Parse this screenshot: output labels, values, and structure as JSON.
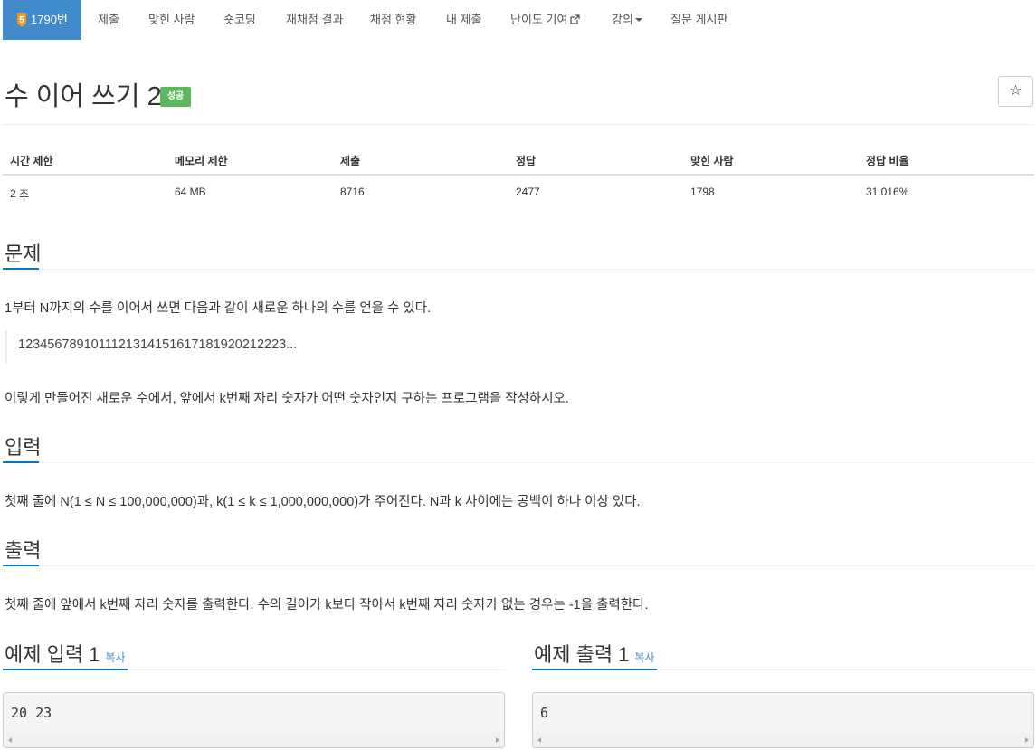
{
  "nav": {
    "problem_id": "1790번",
    "level_num": "5",
    "items": [
      "제출",
      "맞힌 사람",
      "숏코딩",
      "재채점 결과",
      "채점 현황",
      "내 제출",
      "난이도 기여",
      "강의",
      "질문 게시판"
    ]
  },
  "problem": {
    "title": "수 이어 쓰기 2",
    "status_badge": "성공",
    "star": "☆"
  },
  "info_table": {
    "headers": [
      "시간 제한",
      "메모리 제한",
      "제출",
      "정답",
      "맞힌 사람",
      "정답 비율"
    ],
    "values": [
      "2 초",
      "64 MB",
      "8716",
      "2477",
      "1798",
      "31.016%"
    ]
  },
  "sections": {
    "description": {
      "heading": "문제",
      "line1": "1부터 N까지의 수를 이어서 쓰면 다음과 같이 새로운 하나의 수를 얻을 수 있다.",
      "quote": "1234567891011121314151617181920212223...",
      "line2": "이렇게 만들어진 새로운 수에서, 앞에서 k번째 자리 숫자가 어떤 숫자인지 구하는 프로그램을 작성하시오."
    },
    "input": {
      "heading": "입력",
      "text": "첫째 줄에 N(1 ≤ N ≤ 100,000,000)과, k(1 ≤ k ≤ 1,000,000,000)가 주어진다. N과 k 사이에는 공백이 하나 이상 있다."
    },
    "output": {
      "heading": "출력",
      "text": "첫째 줄에 앞에서 k번째 자리 숫자를 출력한다. 수의 길이가 k보다 작아서 k번째 자리 숫자가 없는 경우는 -1을 출력한다."
    }
  },
  "samples": {
    "input_heading": "예제 입력 1",
    "output_heading": "예제 출력 1",
    "copy_label": "복사",
    "input_value": "20 23",
    "output_value": "6"
  },
  "colors": {
    "nav_active": "#428bca",
    "success_badge": "#5cb85c",
    "section_underline": "#0076c0",
    "level_badge": "#ec9a29"
  }
}
